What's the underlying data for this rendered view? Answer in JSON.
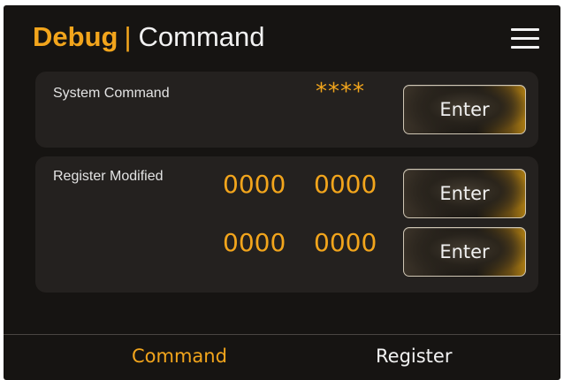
{
  "header": {
    "title_accent": "Debug",
    "title_separator": "|",
    "title_main": "Command",
    "menu_icon": "hamburger-menu-icon"
  },
  "system_command": {
    "label": "System Command",
    "value": "****",
    "button_label": "Enter"
  },
  "register_modified": {
    "label": "Register Modified",
    "rows": [
      {
        "address": "0000",
        "value": "0000",
        "button_label": "Enter"
      },
      {
        "address": "0000",
        "value": "0000",
        "button_label": "Enter"
      }
    ]
  },
  "tabs": [
    {
      "label": "Command",
      "active": true
    },
    {
      "label": "Register",
      "active": false
    }
  ],
  "colors": {
    "accent": "#f2a51c",
    "background": "#161412",
    "panel": "#24211f",
    "text": "#f2f2f2"
  }
}
